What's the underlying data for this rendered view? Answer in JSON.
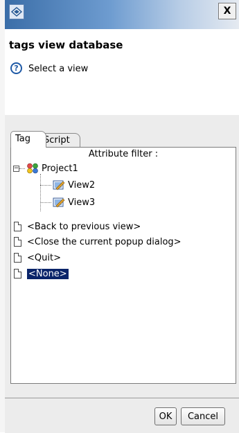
{
  "window": {
    "close_label": "X"
  },
  "header": {
    "title": "tags view database",
    "message": "Select a view"
  },
  "tabs": [
    {
      "label": "Tag",
      "active": true
    },
    {
      "label": "Script",
      "active": false
    }
  ],
  "panel": {
    "filter_label": "Attribute filter :",
    "tree": {
      "project": "Project1",
      "views": [
        "View2",
        "View3"
      ]
    },
    "items": [
      "<Back to previous view>",
      "<Close the current popup dialog>",
      "<Quit>",
      "<None>"
    ],
    "selected_item": "<None>"
  },
  "buttons": {
    "ok": "OK",
    "cancel": "Cancel"
  },
  "colors": {
    "selection": "#0a246a",
    "titlebar_start": "#3b6ea8",
    "help": "#1f5aa6"
  }
}
